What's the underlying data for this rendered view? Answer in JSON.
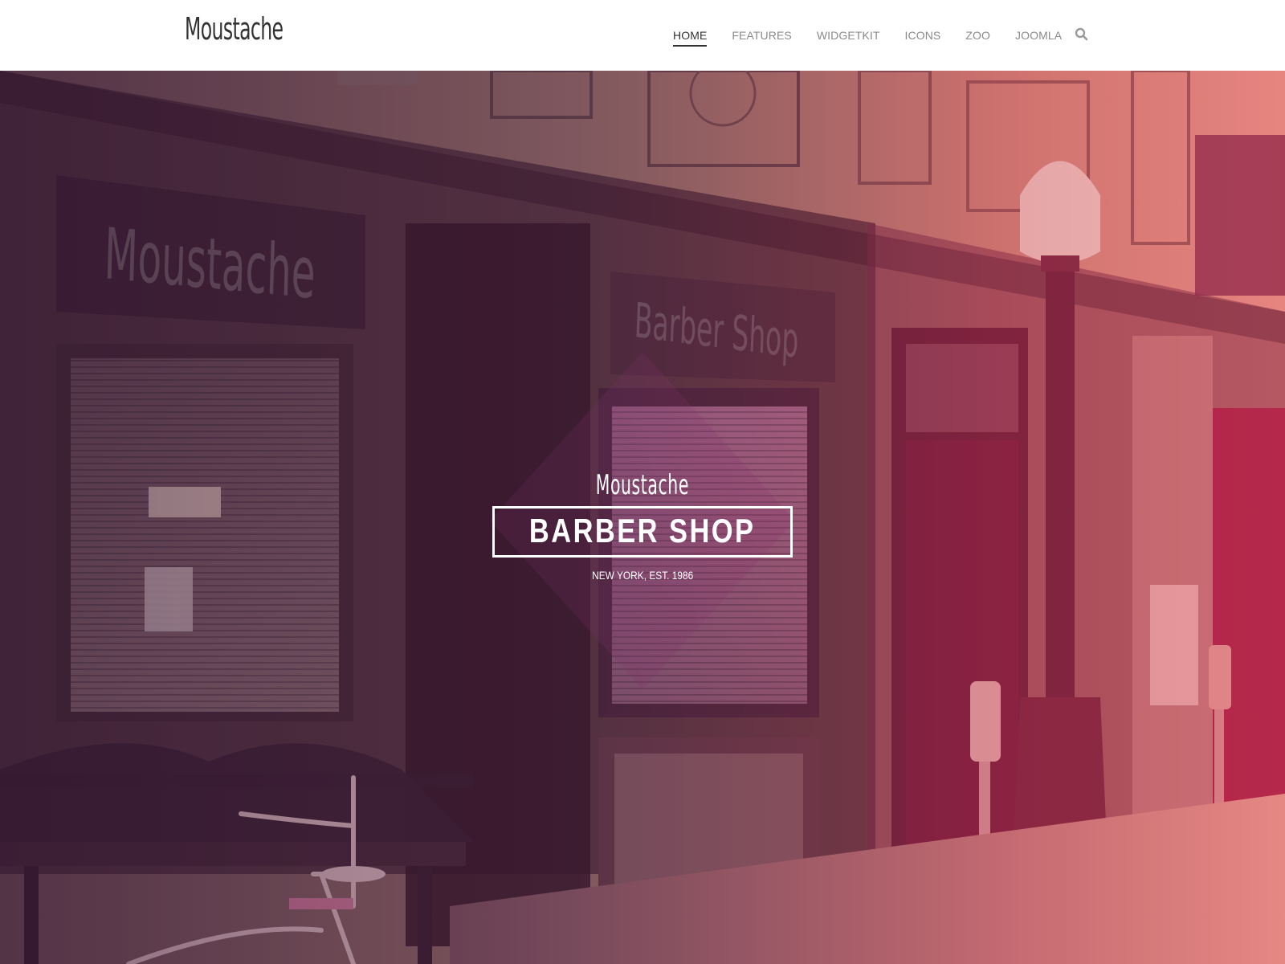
{
  "header": {
    "logo": "Moustache",
    "nav": [
      {
        "label": "HOME",
        "active": true
      },
      {
        "label": "FEATURES",
        "active": false
      },
      {
        "label": "WIDGETKIT",
        "active": false
      },
      {
        "label": "ICONS",
        "active": false
      },
      {
        "label": "ZOO",
        "active": false
      },
      {
        "label": "JOOMLA",
        "active": false
      }
    ],
    "search_icon": "search-icon"
  },
  "hero": {
    "tagline": "Moustache",
    "title": "BARBER SHOP",
    "subtitle": "NEW YORK, EST. 1986",
    "storefront_sign_left": "Moustache",
    "storefront_sign_center": "Barber Shop",
    "overlay_colors": [
      "#3c143c",
      "#5a1e50",
      "#c8285a",
      "#e63c64"
    ]
  }
}
